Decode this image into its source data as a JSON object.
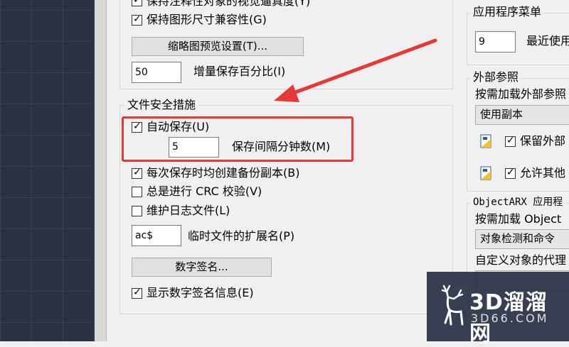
{
  "left_column": {
    "cropped_option_label": "保持注释性对象的视觉逼真度(Y)",
    "keep_dim_compat_label": "保持图形尺寸兼容性(G)",
    "thumbnail_settings_button": "缩略图预览设置(T)...",
    "incremental_save_value": "50",
    "incremental_save_label": "增量保存百分比(I)"
  },
  "file_safety": {
    "title": "文件安全措施",
    "autosave_label": "自动保存(U)",
    "autosave_minutes_value": "5",
    "autosave_minutes_label": "保存间隔分钟数(M)",
    "backup_copy_label": "每次保存时均创建备份副本(B)",
    "crc_check_label": "总是进行 CRC 校验(V)",
    "log_file_label": "维护日志文件(L)",
    "temp_ext_value": "ac$",
    "temp_ext_label": "临时文件的扩展名(P)",
    "digital_sign_button": "数字签名...",
    "show_sign_info_label": "显示数字签名信息(E)"
  },
  "right_column": {
    "app_menu_title": "应用程序菜单",
    "recent_value": "9",
    "recent_label": "最近使用",
    "xref_title": "外部参照",
    "xref_demand_label": "按需加载外部参照",
    "xref_dropdown_value": "使用副本",
    "keep_xref_label": "保留外部",
    "allow_others_label": "允许其他",
    "objectarx_title": "ObjectARX 应用程",
    "demand_load_label": "按需加载 Object",
    "detect_dropdown_value": "对象检测和命令",
    "proxy_label": "自定义对象的代理"
  },
  "watermark": {
    "brand_cn": "3D溜溜网",
    "brand_url": "3D66.COM"
  },
  "colors": {
    "annotation": "#e53935"
  }
}
